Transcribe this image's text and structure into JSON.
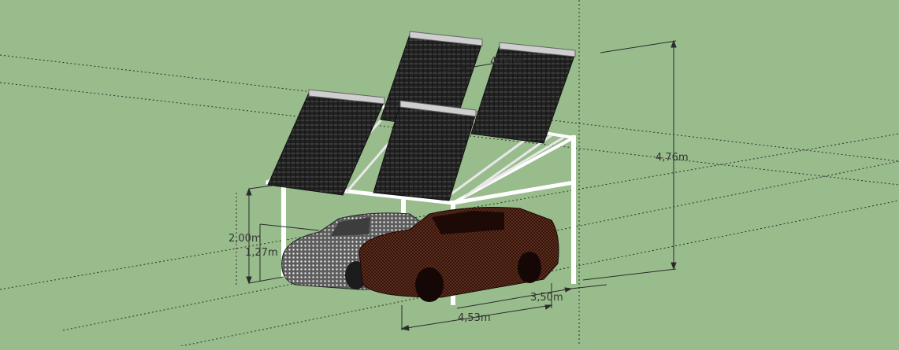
{
  "scene": {
    "background_color": "#98bc8c",
    "structure_color": "#ffffff",
    "panel_color": "#2a2a2a",
    "car_left_color": "#6f6f6f",
    "car_right_color": "#3a1a12"
  },
  "dimensions": {
    "panel_length": "4,00m",
    "total_height": "4,76m",
    "low_side_height": "2,00m",
    "car_height": "1,27m",
    "depth": "3,50m",
    "width": "4,53m"
  }
}
